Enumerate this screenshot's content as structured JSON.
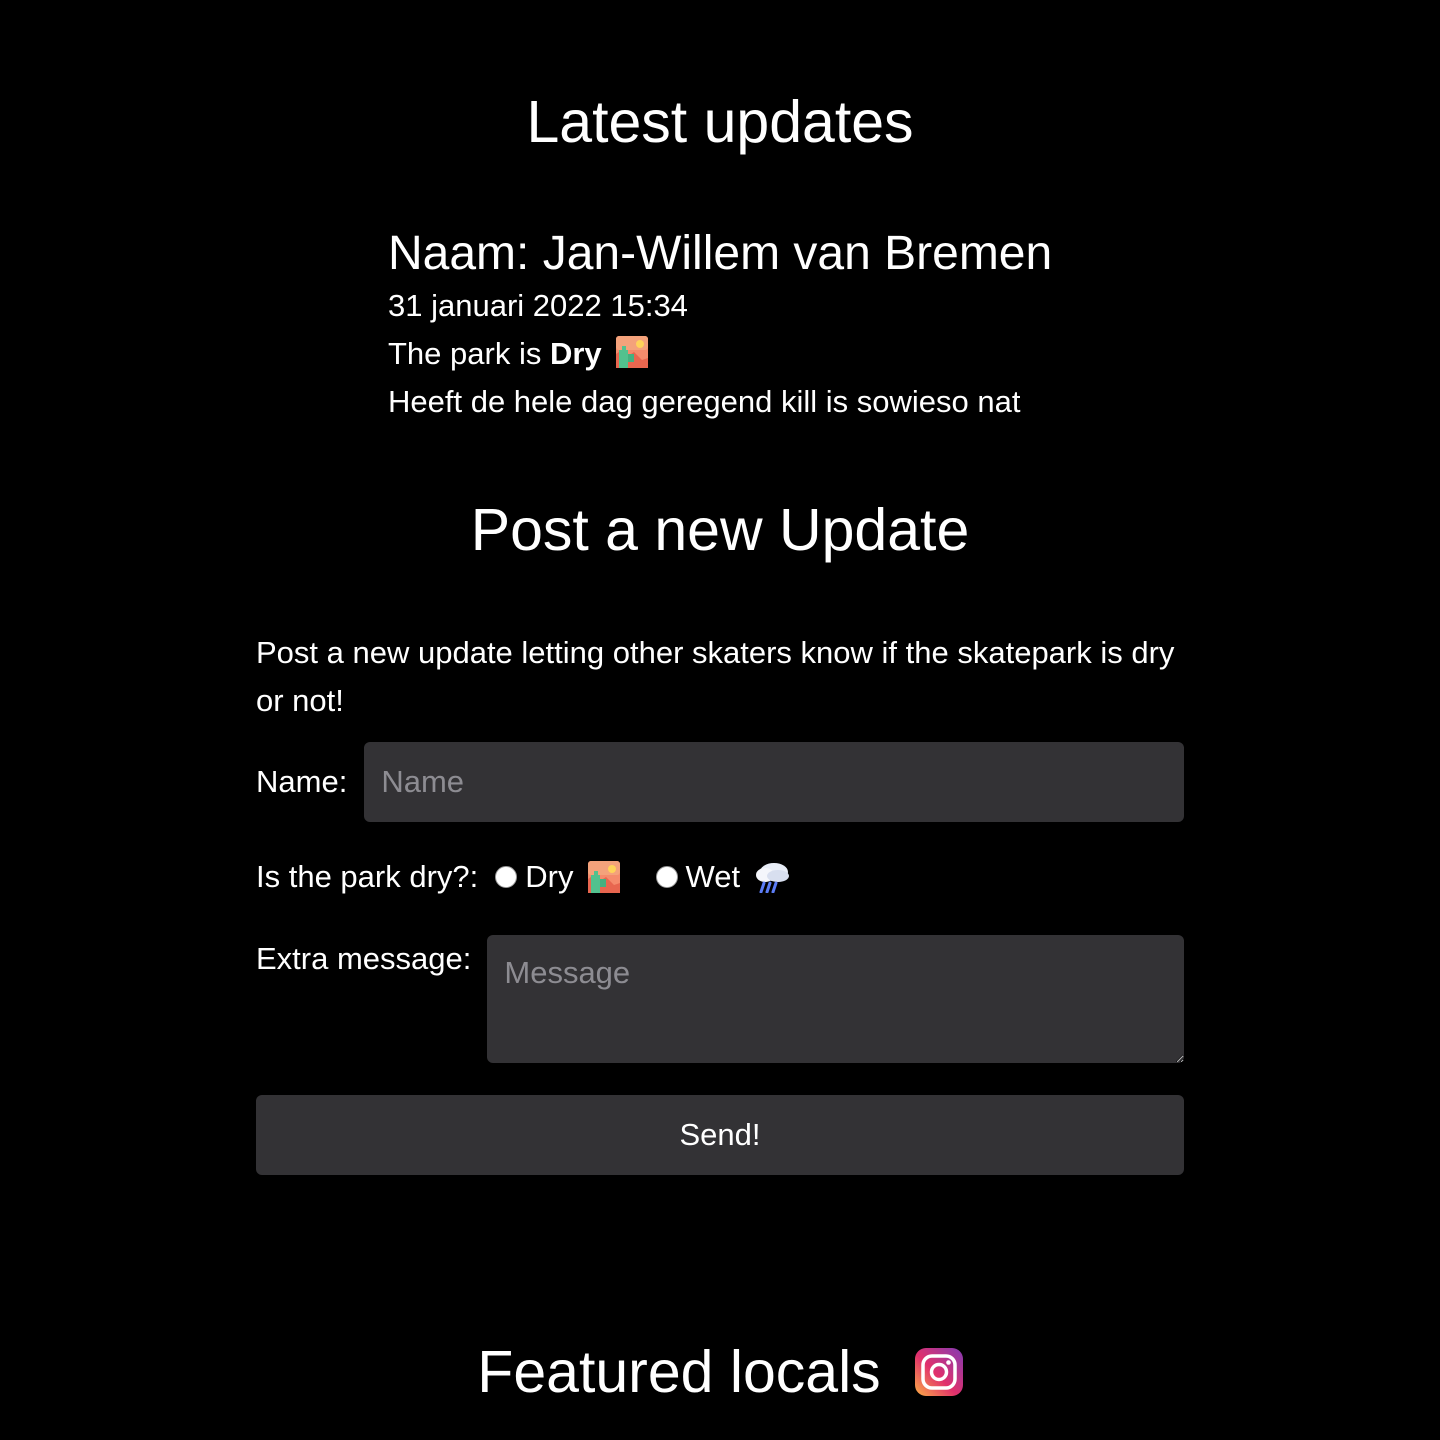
{
  "latest": {
    "title": "Latest updates",
    "update": {
      "name_line": "Naam: Jan-Willem van Bremen",
      "date": "31 januari 2022 15:34",
      "status_prefix": "The park is ",
      "status_value": "Dry",
      "status_icon": "landscape-emoji-icon",
      "message": "Heeft de hele dag geregend kill is sowieso nat"
    }
  },
  "post": {
    "title": "Post a new Update",
    "intro": "Post a new update letting other skaters know if the skatepark is dry or not!",
    "name_label": "Name:",
    "name_placeholder": "Name",
    "dry_question": "Is the park dry?:",
    "option_dry": "Dry",
    "option_dry_icon": "landscape-emoji-icon",
    "option_wet": "Wet",
    "option_wet_icon": "rain-cloud-emoji-icon",
    "message_label": "Extra message:",
    "message_placeholder": "Message",
    "send_label": "Send!"
  },
  "featured": {
    "title": "Featured locals",
    "icon": "instagram-icon"
  },
  "colors": {
    "background": "#000000",
    "text": "#ffffff",
    "input_bg": "#333235",
    "placeholder": "#8d8c92"
  }
}
